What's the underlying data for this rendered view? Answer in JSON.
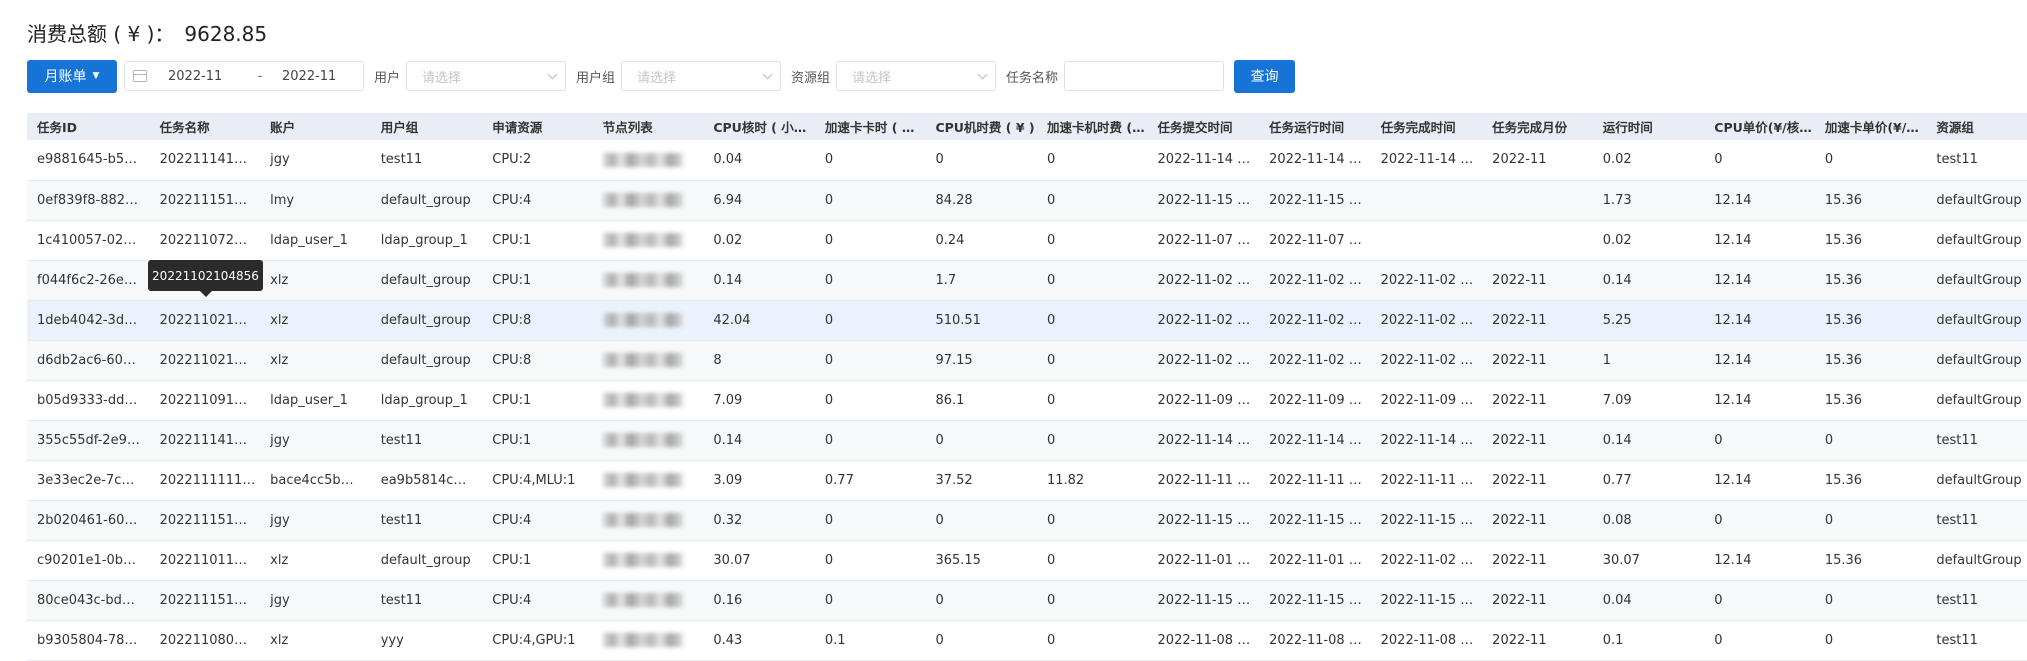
{
  "summary": {
    "label": "消费总额 ( ¥ )：",
    "amount": "9628.85"
  },
  "filters": {
    "bill_type": "月账单",
    "date_start": "2022-11",
    "date_sep": "-",
    "date_end": "2022-11",
    "user_label": "用户",
    "user_placeholder": "请选择",
    "group_label": "用户组",
    "group_placeholder": "请选择",
    "resource_label": "资源组",
    "resource_placeholder": "请选择",
    "task_label": "任务名称",
    "task_value": "",
    "query": "查询"
  },
  "table": {
    "columns": [
      "任务ID",
      "任务名称",
      "账户",
      "用户组",
      "申请资源",
      "节点列表",
      "CPU核时 ( 小时 )",
      "加速卡卡时 ( 小时 )",
      "CPU机时费 ( ¥ )",
      "加速卡机时费 ( ¥ )",
      "任务提交时间",
      "任务运行时间",
      "任务完成时间",
      "任务完成月份",
      "运行时间",
      "CPU单价(¥/核时)",
      "加速卡单价(¥/卡时)",
      "资源组"
    ],
    "rows": [
      [
        "e9881645-b5…",
        "202211141…",
        "jgy",
        "test11",
        "CPU:2",
        "",
        "0.04",
        "0",
        "0",
        "0",
        "2022-11-14 …",
        "2022-11-14 …",
        "2022-11-14 …",
        "2022-11",
        "0.02",
        "0",
        "0",
        "test11"
      ],
      [
        "0ef839f8-882…",
        "202211151…",
        "lmy",
        "default_group",
        "CPU:4",
        "",
        "6.94",
        "0",
        "84.28",
        "0",
        "2022-11-15 …",
        "2022-11-15 …",
        "",
        "",
        "1.73",
        "12.14",
        "15.36",
        "defaultGroup"
      ],
      [
        "1c410057-02…",
        "202211072…",
        "ldap_user_1",
        "ldap_group_1",
        "CPU:1",
        "",
        "0.02",
        "0",
        "0.24",
        "0",
        "2022-11-07 …",
        "2022-11-07 …",
        "",
        "",
        "0.02",
        "12.14",
        "15.36",
        "defaultGroup"
      ],
      [
        "f044f6c2-26e…",
        "202211021…",
        "xlz",
        "default_group",
        "CPU:1",
        "",
        "0.14",
        "0",
        "1.7",
        "0",
        "2022-11-02 …",
        "2022-11-02 …",
        "2022-11-02 …",
        "2022-11",
        "0.14",
        "12.14",
        "15.36",
        "defaultGroup"
      ],
      [
        "1deb4042-3d…",
        "202211021…",
        "xlz",
        "default_group",
        "CPU:8",
        "",
        "42.04",
        "0",
        "510.51",
        "0",
        "2022-11-02 …",
        "2022-11-02 …",
        "2022-11-02 …",
        "2022-11",
        "5.25",
        "12.14",
        "15.36",
        "defaultGroup"
      ],
      [
        "d6db2ac6-60…",
        "202211021…",
        "xlz",
        "default_group",
        "CPU:8",
        "",
        "8",
        "0",
        "97.15",
        "0",
        "2022-11-02 …",
        "2022-11-02 …",
        "2022-11-02 …",
        "2022-11",
        "1",
        "12.14",
        "15.36",
        "defaultGroup"
      ],
      [
        "b05d9333-dd…",
        "202211091…",
        "ldap_user_1",
        "ldap_group_1",
        "CPU:1",
        "",
        "7.09",
        "0",
        "86.1",
        "0",
        "2022-11-09 …",
        "2022-11-09 …",
        "2022-11-09 …",
        "2022-11",
        "7.09",
        "12.14",
        "15.36",
        "defaultGroup"
      ],
      [
        "355c55df-2e9…",
        "202211141…",
        "jgy",
        "test11",
        "CPU:1",
        "",
        "0.14",
        "0",
        "0",
        "0",
        "2022-11-14 …",
        "2022-11-14 …",
        "2022-11-14 …",
        "2022-11",
        "0.14",
        "0",
        "0",
        "test11"
      ],
      [
        "3e33ec2e-7c…",
        "20221111114…",
        "bace4cc5b…",
        "ea9b5814c…",
        "CPU:4,MLU:1",
        "",
        "3.09",
        "0.77",
        "37.52",
        "11.82",
        "2022-11-11 …",
        "2022-11-11 …",
        "2022-11-11 …",
        "2022-11",
        "0.77",
        "12.14",
        "15.36",
        "defaultGroup"
      ],
      [
        "2b020461-60…",
        "202211151…",
        "jgy",
        "test11",
        "CPU:4",
        "",
        "0.32",
        "0",
        "0",
        "0",
        "2022-11-15 …",
        "2022-11-15 …",
        "2022-11-15 …",
        "2022-11",
        "0.08",
        "0",
        "0",
        "test11"
      ],
      [
        "c90201e1-0b…",
        "202211011…",
        "xlz",
        "default_group",
        "CPU:1",
        "",
        "30.07",
        "0",
        "365.15",
        "0",
        "2022-11-01 …",
        "2022-11-01 …",
        "2022-11-02 …",
        "2022-11",
        "30.07",
        "12.14",
        "15.36",
        "defaultGroup"
      ],
      [
        "80ce043c-bd…",
        "202211151…",
        "jgy",
        "test11",
        "CPU:4",
        "",
        "0.16",
        "0",
        "0",
        "0",
        "2022-11-15 …",
        "2022-11-15 …",
        "2022-11-15 …",
        "2022-11",
        "0.04",
        "0",
        "0",
        "test11"
      ],
      [
        "b9305804-78…",
        "202211080…",
        "xlz",
        "yyy",
        "CPU:4,GPU:1",
        "",
        "0.43",
        "0.1",
        "0",
        "0",
        "2022-11-08 …",
        "2022-11-08 …",
        "2022-11-08 …",
        "2022-11",
        "0.1",
        "0",
        "0",
        "test11"
      ]
    ]
  },
  "tooltip": {
    "text": "20221102104856"
  }
}
